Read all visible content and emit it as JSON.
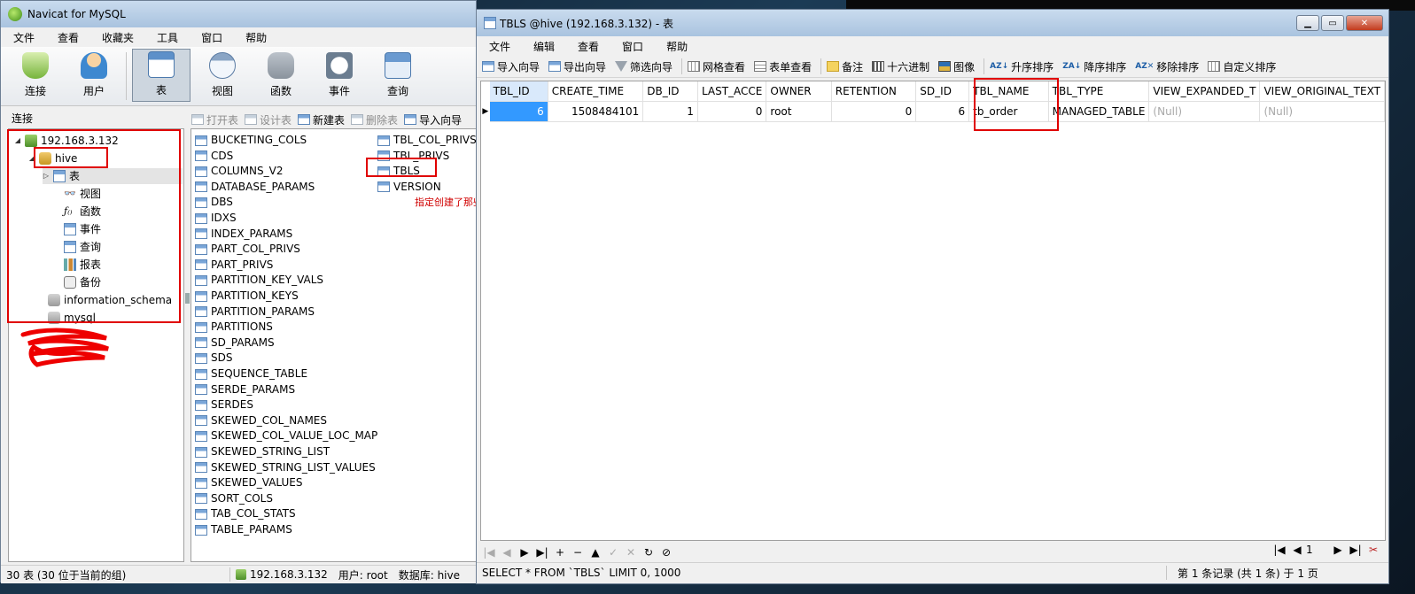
{
  "left_window": {
    "title": "Navicat for MySQL",
    "menu": [
      "文件",
      "查看",
      "收藏夹",
      "工具",
      "窗口",
      "帮助"
    ],
    "toolbar": {
      "connect": "连接",
      "user": "用户",
      "table": "表",
      "view": "视图",
      "function": "函数",
      "event": "事件",
      "query": "查询"
    },
    "connections_label": "连接",
    "object_toolbar": {
      "open": "打开表",
      "design": "设计表",
      "new": "新建表",
      "delete": "删除表",
      "import": "导入向导"
    },
    "tree": {
      "server": "192.168.3.132",
      "db_hive": "hive",
      "node_tables": "表",
      "node_views": "视图",
      "node_functions": "函数",
      "node_events": "事件",
      "node_queries": "查询",
      "node_reports": "报表",
      "node_backups": "备份",
      "db_information_schema": "information_schema",
      "db_mysql": "mysql"
    },
    "tables_col1": [
      "BUCKETING_COLS",
      "CDS",
      "COLUMNS_V2",
      "DATABASE_PARAMS",
      "DBS",
      "IDXS",
      "INDEX_PARAMS",
      "PART_COL_PRIVS",
      "PART_PRIVS",
      "PARTITION_KEY_VALS",
      "PARTITION_KEYS",
      "PARTITION_PARAMS",
      "PARTITIONS",
      "SD_PARAMS",
      "SDS",
      "SEQUENCE_TABLE",
      "SERDE_PARAMS",
      "SERDES",
      "SKEWED_COL_NAMES",
      "SKEWED_COL_VALUE_LOC_MAP",
      "SKEWED_STRING_LIST",
      "SKEWED_STRING_LIST_VALUES",
      "SKEWED_VALUES",
      "SORT_COLS",
      "TAB_COL_STATS",
      "TABLE_PARAMS"
    ],
    "tables_col2": [
      "TBL_COL_PRIVS",
      "TBL_PRIVS",
      "TBLS",
      "VERSION"
    ],
    "annotation_note": "指定创建了那些数据表",
    "status": {
      "count": "30 表 (30 位于当前的组)",
      "server": "192.168.3.132",
      "user": "用户: root",
      "database": "数据库: hive"
    }
  },
  "right_window": {
    "title": "TBLS @hive (192.168.3.132) - 表",
    "menu": [
      "文件",
      "编辑",
      "查看",
      "窗口",
      "帮助"
    ],
    "toolbar": {
      "import_wizard": "导入向导",
      "export_wizard": "导出向导",
      "filter_wizard": "筛选向导",
      "grid_view": "网格查看",
      "form_view": "表单查看",
      "memo": "备注",
      "hex": "十六进制",
      "image": "图像",
      "sort_asc": "升序排序",
      "sort_desc": "降序排序",
      "remove_sort": "移除排序",
      "custom_sort": "自定义排序"
    },
    "columns": [
      "TBL_ID",
      "CREATE_TIME",
      "DB_ID",
      "LAST_ACCE",
      "OWNER",
      "RETENTION",
      "SD_ID",
      "TBL_NAME",
      "TBL_TYPE",
      "VIEW_EXPANDED_T",
      "VIEW_ORIGINAL_TEXT"
    ],
    "rows": [
      [
        "6",
        "1508484101",
        "1",
        "0",
        "root",
        "0",
        "6",
        "tb_order",
        "MANAGED_TABLE",
        "(Null)",
        "(Null)"
      ]
    ],
    "page_number": "1",
    "status": {
      "sql": "SELECT * FROM `TBLS` LIMIT 0, 1000",
      "record_info": "第 1 条记录 (共 1 条) 于 1 页"
    }
  }
}
